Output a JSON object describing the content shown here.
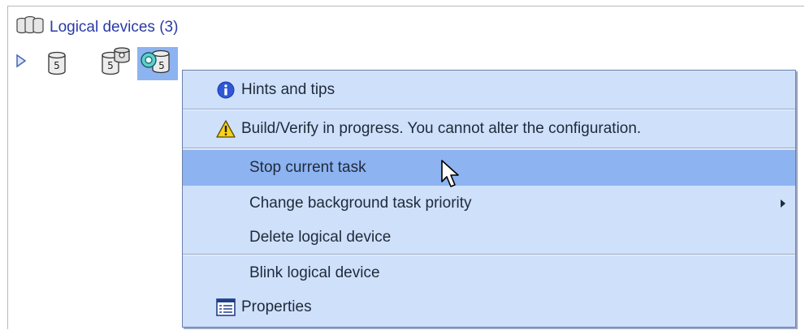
{
  "tree": {
    "title": "Logical devices (3)",
    "devices": [
      {
        "label": "5",
        "icon": "disk-raid5-icon"
      },
      {
        "label": "5",
        "icon": "disk-raid5-with-spare-icon"
      },
      {
        "label": "5",
        "icon": "disk-raid5-verify-icon"
      }
    ]
  },
  "menu": {
    "hints": "Hints and tips",
    "warning": "Build/Verify in progress.  You cannot alter the configuration.",
    "stop": "Stop current task",
    "priority": "Change background task priority",
    "delete": "Delete logical device",
    "blink": "Blink logical device",
    "properties": "Properties"
  },
  "colors": {
    "menu_bg": "#cfe0fb",
    "selection": "#8db3f0",
    "title_text": "#2a3aa8"
  }
}
